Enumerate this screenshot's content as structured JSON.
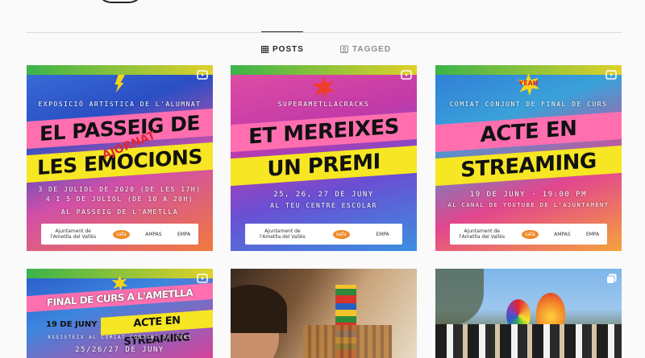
{
  "tabs": [
    {
      "label": "POSTS",
      "icon": "grid-icon",
      "active": true
    },
    {
      "label": "TAGGED",
      "icon": "tagged-icon",
      "active": false
    }
  ],
  "posts": [
    {
      "type": "reel",
      "subtitle": "EXPOSICIÓ ARTÍSTICA DE L'ALUMNAT",
      "title_line1": "EL PASSEIG DE",
      "title_line2": "LES EMOCIONS",
      "stamp": "AJORNAT",
      "detail_line1": "3 DE JULIOL DE 2020 (DE LES 17H)",
      "detail_line2": "4 I 5 DE JULIOL (DE 10 A 20H)",
      "detail_line3": "AL PASSEIG DE L'AMETLLA",
      "logos": [
        "Ajuntament de l'Ametlla del Vallès",
        "safa",
        "AMPAS",
        "EMPA"
      ]
    },
    {
      "type": "reel",
      "subtitle": "SUPERAMETLLACRACKS",
      "title_line1": "ET MEREIXES",
      "title_line2": "UN PREMI",
      "detail_line1": "25, 26, 27 DE JUNY",
      "detail_line2": "AL TEU CENTRE ESCOLAR",
      "logos": [
        "Ajuntament de l'Ametlla del Vallès",
        "safa",
        "EMPA"
      ]
    },
    {
      "type": "reel",
      "burst": "YEAH",
      "subtitle": "COMIAT CONJUNT DE FINAL DE CURS",
      "title_line1": "ACTE EN",
      "title_line2": "STREAMING",
      "detail_line1": "19 DE JUNY · 19:00 PM",
      "detail_line2": "AL CANAL DE YOUTUBE DE L'AJUNTAMENT",
      "logos": [
        "Ajuntament de l'Ametlla del Vallès",
        "safa",
        "AMPAS",
        "EMPA"
      ]
    },
    {
      "type": "reel",
      "title_line1": "FINAL DE CURS A L'AMETLLA",
      "date": "19 DE JUNY  19H",
      "title_line2": "ACTE EN STREAMING",
      "sub": "ASSISTEIX AL COMIAT CONJUNT DE CURS",
      "detail_line1": "25/26/27 DE JUNY"
    },
    {
      "type": "photo"
    },
    {
      "type": "multi"
    }
  ],
  "colors": {
    "active_tab": "#262626",
    "inactive_tab": "#8e8e8e",
    "divider": "#dbdbdb"
  }
}
